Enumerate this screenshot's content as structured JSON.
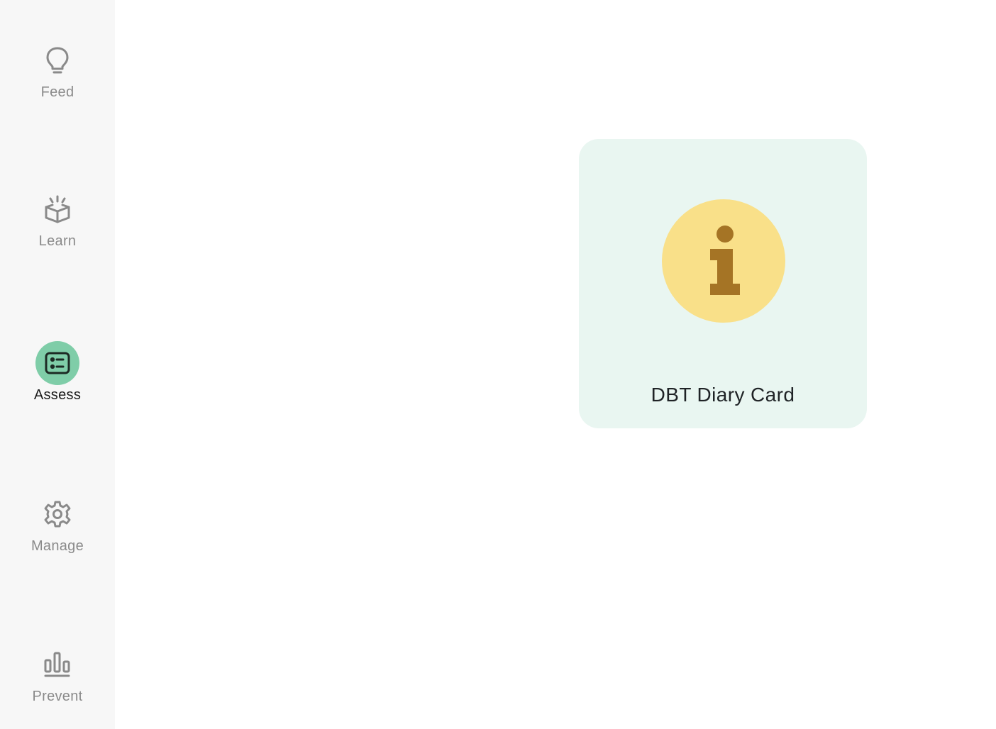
{
  "sidebar": {
    "items": [
      {
        "label": "Feed",
        "icon": "lightbulb-icon",
        "active": false
      },
      {
        "label": "Learn",
        "icon": "open-book-icon",
        "active": false
      },
      {
        "label": "Assess",
        "icon": "checklist-card-icon",
        "active": true
      },
      {
        "label": "Manage",
        "icon": "gear-icon",
        "active": false
      },
      {
        "label": "Prevent",
        "icon": "bar-chart-icon",
        "active": false
      }
    ]
  },
  "main": {
    "cards": [
      {
        "title": "DBT Diary Card",
        "icon": "info-icon"
      }
    ]
  },
  "colors": {
    "sidebar_bg": "#f7f7f7",
    "active_accent": "#7fcda8",
    "card_bg": "#e9f6f1",
    "info_badge": "#f9e089",
    "info_glyph": "#a57425",
    "inactive_text": "#8a8a8a"
  }
}
